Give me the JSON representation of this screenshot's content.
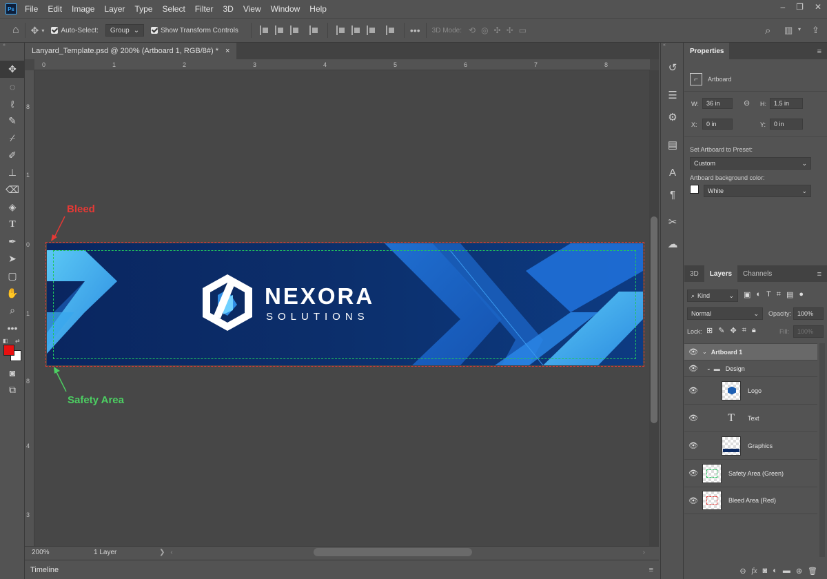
{
  "app": {
    "logo_text": "Ps",
    "menu": [
      "File",
      "Edit",
      "Image",
      "Layer",
      "Type",
      "Select",
      "Filter",
      "3D",
      "View",
      "Window",
      "Help"
    ]
  },
  "options_bar": {
    "auto_select_label": "Auto-Select:",
    "auto_select_value": "Group",
    "transform_label": "Show Transform Controls",
    "mode_3d_label": "3D Mode:"
  },
  "document": {
    "tab_title": "Lanyard_Template.psd @ 200% (Artboard 1, RGB/8#) *",
    "close_glyph": "×",
    "zoom": "200%",
    "status": "1 Layer",
    "h_ruler": [
      "0",
      "1",
      "2",
      "3",
      "4",
      "5",
      "6",
      "7",
      "8"
    ],
    "v_ruler": [
      "8",
      "1",
      "0",
      "1",
      "8",
      "4",
      "3"
    ]
  },
  "artboard": {
    "brand_name": "NEXORA",
    "brand_tagline": "SOLUTIONS",
    "bleed_label": "Bleed",
    "safety_label": "Safety Area",
    "bleed_color": "#e53935",
    "safety_color": "#22c55e",
    "bg_color": "#0b2a63",
    "accent_color": "#2f8de4"
  },
  "timeline": {
    "label": "Timeline"
  },
  "properties": {
    "tab": "Properties",
    "type": "Artboard",
    "w_label": "W:",
    "w_value": "36 in",
    "h_label": "H:",
    "h_value": "1.5 in",
    "x_label": "X:",
    "x_value": "0 in",
    "y_label": "Y:",
    "y_value": "0 in",
    "preset_label": "Set Artboard to Preset:",
    "preset_value": "Custom",
    "bgcolor_label": "Artboard background color:",
    "bgcolor_value": "White"
  },
  "layers_panel": {
    "tabs": [
      "3D",
      "Layers",
      "Channels"
    ],
    "filter_kind": "Kind",
    "blend_mode": "Normal",
    "opacity_label": "Opacity:",
    "opacity_value": "100%",
    "lock_label": "Lock:",
    "fill_label": "Fill:",
    "fill_value": "100%",
    "layers": [
      {
        "name": "Artboard 1"
      },
      {
        "name": "Design"
      },
      {
        "name": "Logo"
      },
      {
        "name": "Text"
      },
      {
        "name": "Graphics"
      },
      {
        "name": "Safety Area (Green)"
      },
      {
        "name": "Bleed Area (Red)"
      }
    ]
  }
}
